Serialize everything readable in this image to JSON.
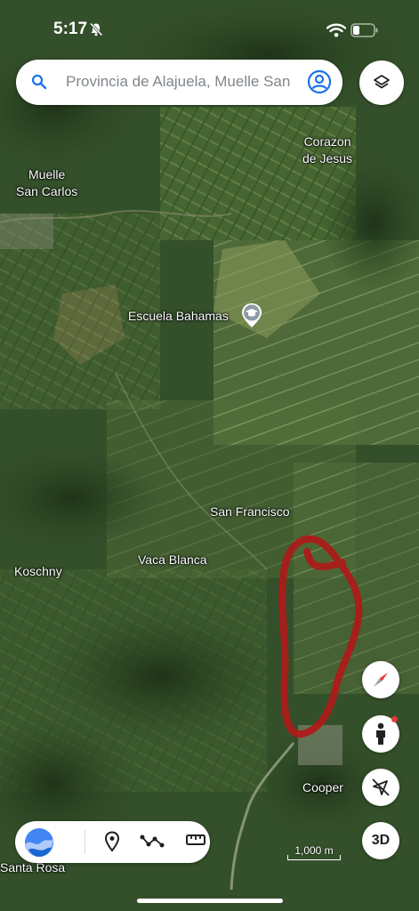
{
  "status": {
    "time": "5:17"
  },
  "search": {
    "text": "Provincia de Alajuela, Muelle San Carlos"
  },
  "map_labels": [
    {
      "name": "corazon",
      "text": "Corazon\nde Jesus"
    },
    {
      "name": "muelle",
      "text": "Muelle\nSan Carlos"
    },
    {
      "name": "escuela",
      "text": "Escuela Bahamas"
    },
    {
      "name": "sanfrancisco",
      "text": "San Francisco"
    },
    {
      "name": "koschny",
      "text": "Koschny"
    },
    {
      "name": "vacablanca",
      "text": "Vaca Blanca"
    },
    {
      "name": "cooper",
      "text": "Cooper"
    },
    {
      "name": "santarosa",
      "text": "Santa Rosa"
    }
  ],
  "controls": {
    "btn_3d": "3D"
  },
  "scale": {
    "label": "1,000 m"
  },
  "colors": {
    "route": "#b01818",
    "map_dark": "#243a1d",
    "map_field": "#5d7a3e"
  }
}
